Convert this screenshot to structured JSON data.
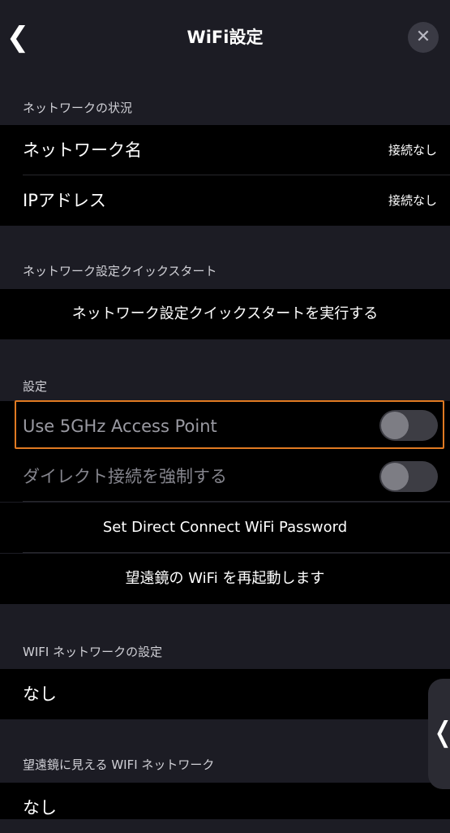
{
  "header": {
    "title": "WiFi設定",
    "back_glyph": "❮",
    "close_glyph": "✕"
  },
  "network_status": {
    "section_label": "ネットワークの状況",
    "network_name_label": "ネットワーク名",
    "network_name_value": "接続なし",
    "ip_label": "IPアドレス",
    "ip_value": "接続なし"
  },
  "quickstart": {
    "section_label": "ネットワーク設定クイックスタート",
    "run_label": "ネットワーク設定クイックスタートを実行する"
  },
  "settings": {
    "section_label": "設定",
    "use_5ghz_label": "Use 5GHz Access Point",
    "use_5ghz_on": false,
    "force_direct_label": "ダイレクト接続を強制する",
    "force_direct_on": false,
    "set_password_label": "Set Direct Connect WiFi Password",
    "restart_wifi_label": "望遠鏡の WiFi を再起動します"
  },
  "wifi_network": {
    "section_label": "WIFI ネットワークの設定",
    "value": "なし"
  },
  "visible_networks": {
    "section_label": "望遠鏡に見える WIFI ネットワーク",
    "value": "なし"
  },
  "side_handle_glyph": "❬",
  "colors": {
    "background": "#1c1c24",
    "row_background": "#000000",
    "highlight": "#e07a22",
    "toggle_track": "#3d3d44",
    "toggle_knob": "#7d7d84"
  }
}
